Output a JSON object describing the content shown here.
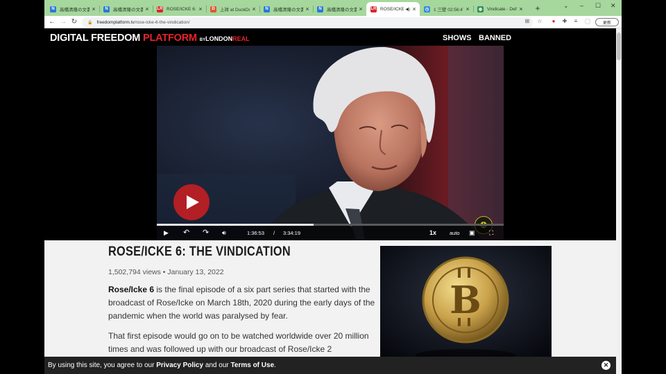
{
  "browser": {
    "tabs": [
      {
        "title": "高橋清隆の文書",
        "icon": "ns-blog-icon",
        "color": "#2a78d6"
      },
      {
        "title": "高橋清隆の文書",
        "icon": "ns-blog-icon",
        "color": "#2a78d6"
      },
      {
        "title": "ROSE/ICKE 6: TH",
        "icon": "london-real-icon",
        "color": "#d8262c"
      },
      {
        "title": "上祥 at DuckDu",
        "icon": "duckduckgo-icon",
        "color": "#de5833"
      },
      {
        "title": "高橋清隆の文書",
        "icon": "ns-blog-icon",
        "color": "#2a78d6"
      },
      {
        "title": "高橋清隆の文書",
        "icon": "ns-blog-icon",
        "color": "#2a78d6"
      },
      {
        "title": "ROSE/ICKE",
        "icon": "london-real-icon",
        "color": "#d8262c",
        "active": true
      },
      {
        "title": "1 三壁 02:56:47",
        "icon": "clock-icon",
        "color": "#3a8dde"
      },
      {
        "title": "Vindicate - Defi",
        "icon": "globe-icon",
        "color": "#2f8f5b"
      }
    ],
    "new_tab": "+",
    "url_host": "freedomplatform.tv",
    "url_path": "/rose-icke-6-the-vindication/",
    "update_label": "更新",
    "colors": {
      "tabstrip": "#a6d79d",
      "accent": "#e8232a"
    }
  },
  "site": {
    "logo_main": "DIGITAL FREEDOM",
    "logo_accent": "PLATFORM",
    "logo_by": "BY",
    "logo_brand": "LONDON",
    "logo_brand_accent": "REAL",
    "nav": [
      "SHOWS",
      "BANNED"
    ]
  },
  "player": {
    "current_time": "1:36:53",
    "separator": "/",
    "duration": "3:34:19",
    "speed": "1x",
    "quality": "auto",
    "progress": 0.452
  },
  "article": {
    "title": "ROSE/ICKE 6: THE VINDICATION",
    "views": "1,502,794 views",
    "date": "January 13, 2022",
    "p1_bold": "Rose/Icke 6",
    "p1_rest": " is the final episode of a six part series that started with the broadcast of Rose/Icke on March 18th, 2020 during the early days of the pandemic when the world was paralysed by fear.",
    "p2": "That first episode would go on to be watched worldwide over 20 million times and was followed up with our broadcast of Rose/Icke 2"
  },
  "cookie": {
    "text_1": "By using this site, you agree to our ",
    "privacy": "Privacy Policy",
    "text_2": " and our ",
    "terms": "Terms of Use",
    "text_3": "."
  }
}
